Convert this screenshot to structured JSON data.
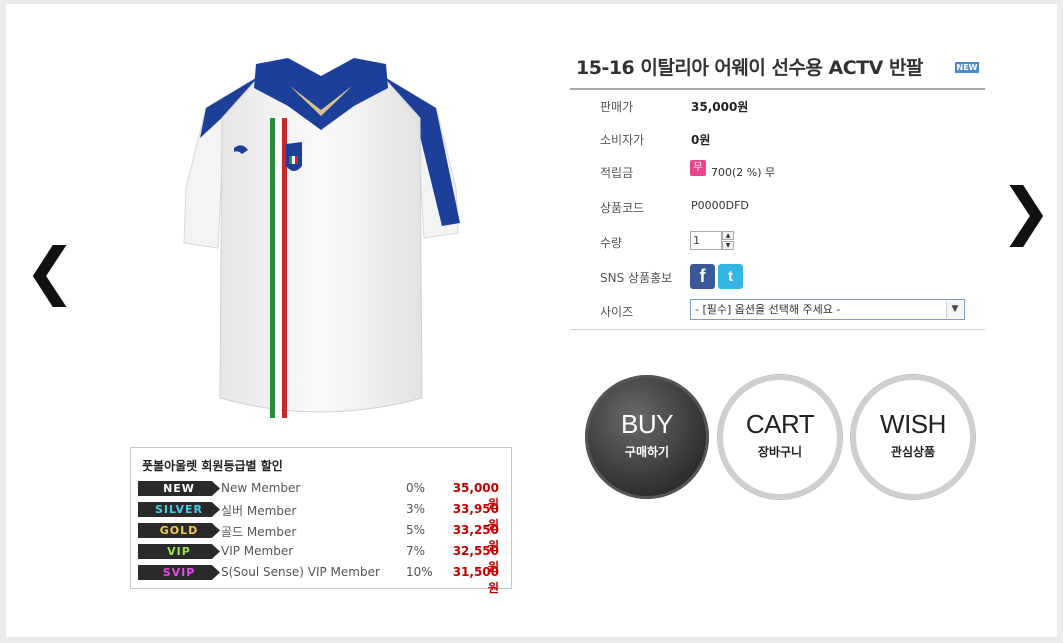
{
  "nav": {
    "prev_icon": "❮",
    "next_icon": "❯"
  },
  "product": {
    "title": "15-16 이탈리아 어웨이 선수용 ACTV 반팔",
    "new_badge": "NEW",
    "fields": {
      "price_label": "판매가",
      "price_value": "35,000원",
      "consumer_label": "소비자가",
      "consumer_value": "0원",
      "points_label": "적립금",
      "points_icon": "무",
      "points_value": "700(2 %) 무",
      "code_label": "상품코드",
      "code_value": "P0000DFD",
      "qty_label": "수량",
      "qty_value": "1",
      "sns_label": "SNS 상품홍보",
      "facebook_icon": "f",
      "twitter_icon": "t",
      "size_label": "사이즈",
      "size_placeholder": "- [필수] 옵션을 선택해 주세요 -"
    }
  },
  "buttons": {
    "buy": {
      "main": "BUY",
      "sub": "구매하기"
    },
    "cart": {
      "main": "CART",
      "sub": "장바구니"
    },
    "wish": {
      "main": "WISH",
      "sub": "관심상품"
    }
  },
  "discount": {
    "title": "풋볼아울렛 회원등급별 할인",
    "rows": [
      {
        "badge": "NEW",
        "badge_color": "#ffffff",
        "name": "New Member",
        "pct": "0%",
        "price": "35,000원"
      },
      {
        "badge": "SILVER",
        "badge_color": "#3fd0e8",
        "name": "실버 Member",
        "pct": "3%",
        "price": "33,950원"
      },
      {
        "badge": "GOLD",
        "badge_color": "#f2c94c",
        "name": "골드 Member",
        "pct": "5%",
        "price": "33,250원"
      },
      {
        "badge": "VIP",
        "badge_color": "#9be34a",
        "name": "VIP Member",
        "pct": "7%",
        "price": "32,550원"
      },
      {
        "badge": "SVIP",
        "badge_color": "#e04ae8",
        "name": "S(Soul Sense) VIP Member",
        "pct": "10%",
        "price": "31,500원"
      }
    ]
  },
  "colors": {
    "price_red": "#c00000",
    "shirt_blue": "#1c3f9a",
    "italy_green": "#2a8a3e",
    "italy_red": "#c82a2a"
  }
}
